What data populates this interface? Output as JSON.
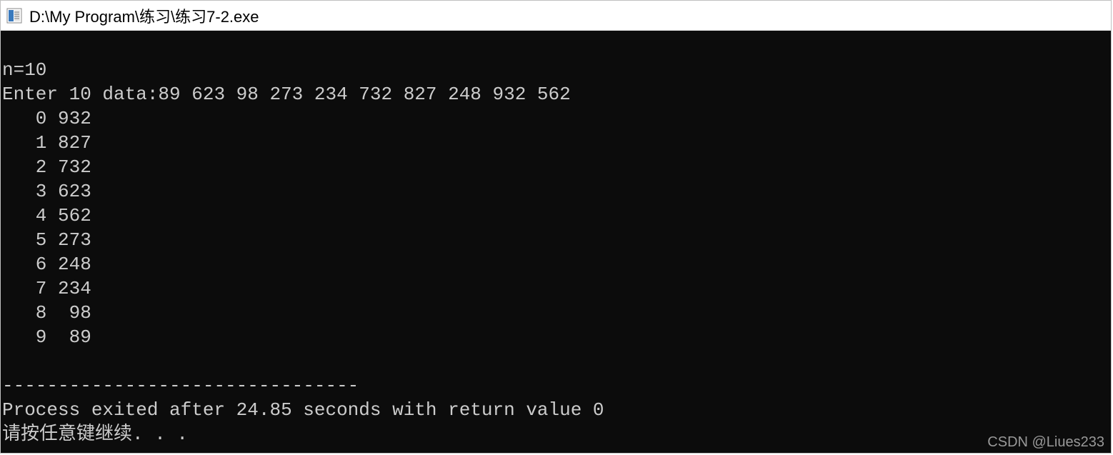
{
  "window": {
    "title": "D:\\My Program\\练习\\练习7-2.exe"
  },
  "console": {
    "lines": [
      "n=10",
      "Enter 10 data:89 623 98 273 234 732 827 248 932 562",
      "   0 932",
      "   1 827",
      "   2 732",
      "   3 623",
      "   4 562",
      "   5 273",
      "   6 248",
      "   7 234",
      "   8  98",
      "   9  89",
      "",
      "--------------------------------",
      "Process exited after 24.85 seconds with return value 0",
      "请按任意键继续. . ."
    ]
  },
  "watermark": "CSDN @Liues233"
}
